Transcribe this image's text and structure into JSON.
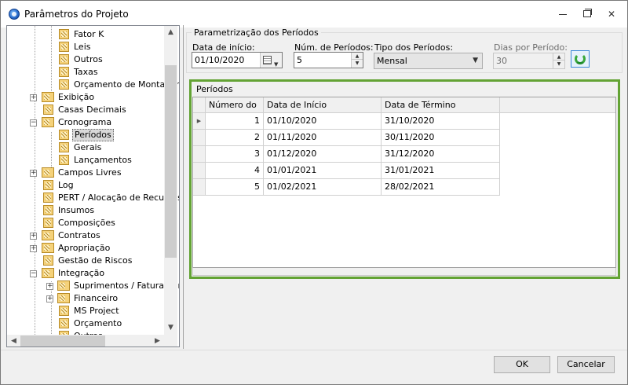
{
  "window": {
    "title": "Parâmetros do Projeto",
    "icon": "app-logo-icon",
    "controls": [
      "minimize-icon",
      "maximize-icon",
      "close-icon"
    ],
    "close_glyph": "✕"
  },
  "tree": {
    "items": [
      {
        "label": "Fator K",
        "level": 2,
        "expander": null
      },
      {
        "label": "Leis",
        "level": 2,
        "expander": null
      },
      {
        "label": "Outros",
        "level": 2,
        "expander": null
      },
      {
        "label": "Taxas",
        "level": 2,
        "expander": null
      },
      {
        "label": "Orçamento de Montagem",
        "level": 2,
        "expander": null
      },
      {
        "label": "Exibição",
        "level": 1,
        "expander": "+"
      },
      {
        "label": "Casas Decimais",
        "level": 1,
        "expander": null
      },
      {
        "label": "Cronograma",
        "level": 1,
        "expander": "-"
      },
      {
        "label": "Períodos",
        "level": 2,
        "expander": null,
        "selected": true
      },
      {
        "label": "Gerais",
        "level": 2,
        "expander": null
      },
      {
        "label": "Lançamentos",
        "level": 2,
        "expander": null
      },
      {
        "label": "Campos Livres",
        "level": 1,
        "expander": "+"
      },
      {
        "label": "Log",
        "level": 1,
        "expander": null
      },
      {
        "label": "PERT / Alocação de Recursos",
        "level": 1,
        "expander": null
      },
      {
        "label": "Insumos",
        "level": 1,
        "expander": null
      },
      {
        "label": "Composições",
        "level": 1,
        "expander": null
      },
      {
        "label": "Contratos",
        "level": 1,
        "expander": "+"
      },
      {
        "label": "Apropriação",
        "level": 1,
        "expander": "+"
      },
      {
        "label": "Gestão de Riscos",
        "level": 1,
        "expander": null
      },
      {
        "label": "Integração",
        "level": 1,
        "expander": "-"
      },
      {
        "label": "Suprimentos / Faturamento",
        "level": 2,
        "expander": "+"
      },
      {
        "label": "Financeiro",
        "level": 2,
        "expander": "+"
      },
      {
        "label": "MS Project",
        "level": 2,
        "expander": null
      },
      {
        "label": "Orçamento",
        "level": 2,
        "expander": null
      },
      {
        "label": "Outros",
        "level": 2,
        "expander": null
      }
    ],
    "scroll_up": "▲",
    "scroll_down": "▼",
    "scroll_left": "◀",
    "scroll_right": "▶"
  },
  "params": {
    "group_title": "Parametrização dos Períodos",
    "start_date_label": "Data de início:",
    "start_date_value": "01/10/2020",
    "num_periods_label": "Núm. de Períodos:",
    "num_periods_value": "5",
    "period_type_label": "Tipo dos Períodos:",
    "period_type_value": "Mensal",
    "days_per_period_label": "Dias por Período:",
    "days_per_period_value": "30",
    "spin_up": "▲",
    "spin_down": "▼",
    "dropdown": "▼"
  },
  "periods": {
    "group_title": "Períodos",
    "columns": [
      "Número do ...",
      "Data de Início",
      "Data de Término"
    ],
    "rows": [
      {
        "num": "1",
        "start": "01/10/2020",
        "end": "31/10/2020",
        "current": true
      },
      {
        "num": "2",
        "start": "01/11/2020",
        "end": "30/11/2020"
      },
      {
        "num": "3",
        "start": "01/12/2020",
        "end": "31/12/2020"
      },
      {
        "num": "4",
        "start": "01/01/2021",
        "end": "31/01/2021"
      },
      {
        "num": "5",
        "start": "01/02/2021",
        "end": "28/02/2021"
      }
    ],
    "row_marker": "▶",
    "highlight_color": "#63a334"
  },
  "footer": {
    "ok_label": "OK",
    "cancel_label": "Cancelar"
  }
}
